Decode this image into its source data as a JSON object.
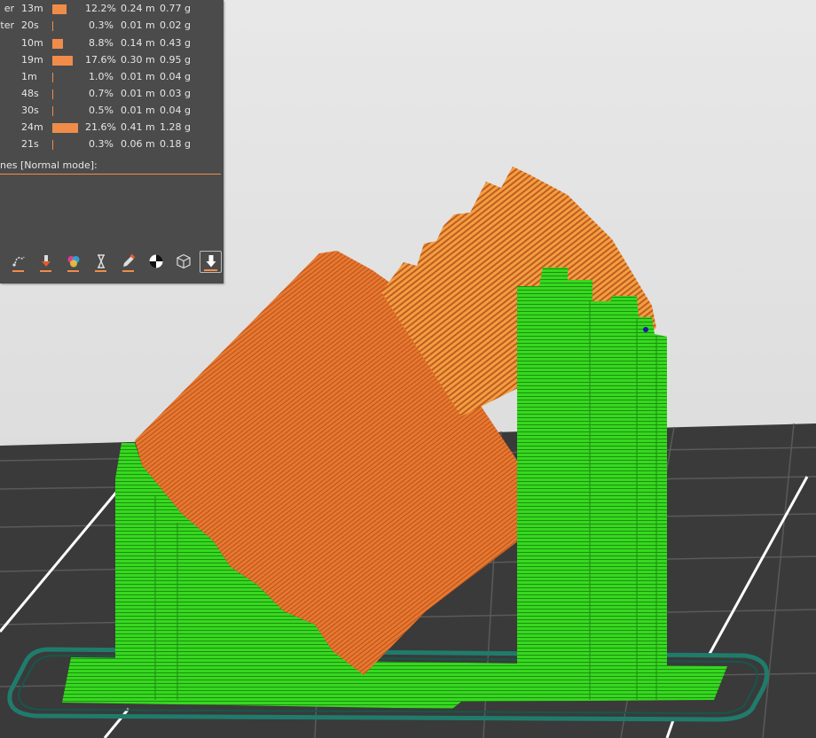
{
  "stats": {
    "rows": [
      {
        "name": "er",
        "time": "13m",
        "bar": 0.56,
        "percent": "12.2%",
        "length": "0.24 m",
        "weight": "0.77 g"
      },
      {
        "name": "eter",
        "time": "20s",
        "bar": 0.02,
        "percent": "0.3%",
        "length": "0.01 m",
        "weight": "0.02 g"
      },
      {
        "name": "",
        "time": "10m",
        "bar": 0.41,
        "percent": "8.8%",
        "length": "0.14 m",
        "weight": "0.43 g"
      },
      {
        "name": "",
        "time": "19m",
        "bar": 0.81,
        "percent": "17.6%",
        "length": "0.30 m",
        "weight": "0.95 g"
      },
      {
        "name": "",
        "time": "1m",
        "bar": 0.02,
        "percent": "1.0%",
        "length": "0.01 m",
        "weight": "0.04 g"
      },
      {
        "name": "",
        "time": "48s",
        "bar": 0.02,
        "percent": "0.7%",
        "length": "0.01 m",
        "weight": "0.03 g"
      },
      {
        "name": "",
        "time": "30s",
        "bar": 0.02,
        "percent": "0.5%",
        "length": "0.01 m",
        "weight": "0.04 g"
      },
      {
        "name": "",
        "time": "24m",
        "bar": 1.0,
        "percent": "21.6%",
        "length": "0.41 m",
        "weight": "1.28 g"
      },
      {
        "name": "",
        "time": "21s",
        "bar": 0.02,
        "percent": "0.3%",
        "length": "0.06 m",
        "weight": "0.18 g"
      }
    ],
    "mode_label": "nes [Normal mode]:"
  },
  "toolbar": {
    "buttons": [
      {
        "icon": "travel-icon"
      },
      {
        "icon": "retraction-icon"
      },
      {
        "icon": "color-change-icon"
      },
      {
        "icon": "pause-icon"
      },
      {
        "icon": "custom-gcode-icon"
      },
      {
        "icon": "seam-icon"
      },
      {
        "icon": "bounding-box-icon"
      },
      {
        "icon": "legend-icon"
      }
    ]
  },
  "colors": {
    "panel_bg": "#4b4b4b",
    "accent": "#f08c49",
    "perimeter": "#e26f2c",
    "perimeter_light": "#f09a40",
    "infill": "#2ed31a",
    "skirt": "#1e6e60",
    "bed": "#3a3a3a",
    "background": "#e3e3e3"
  }
}
